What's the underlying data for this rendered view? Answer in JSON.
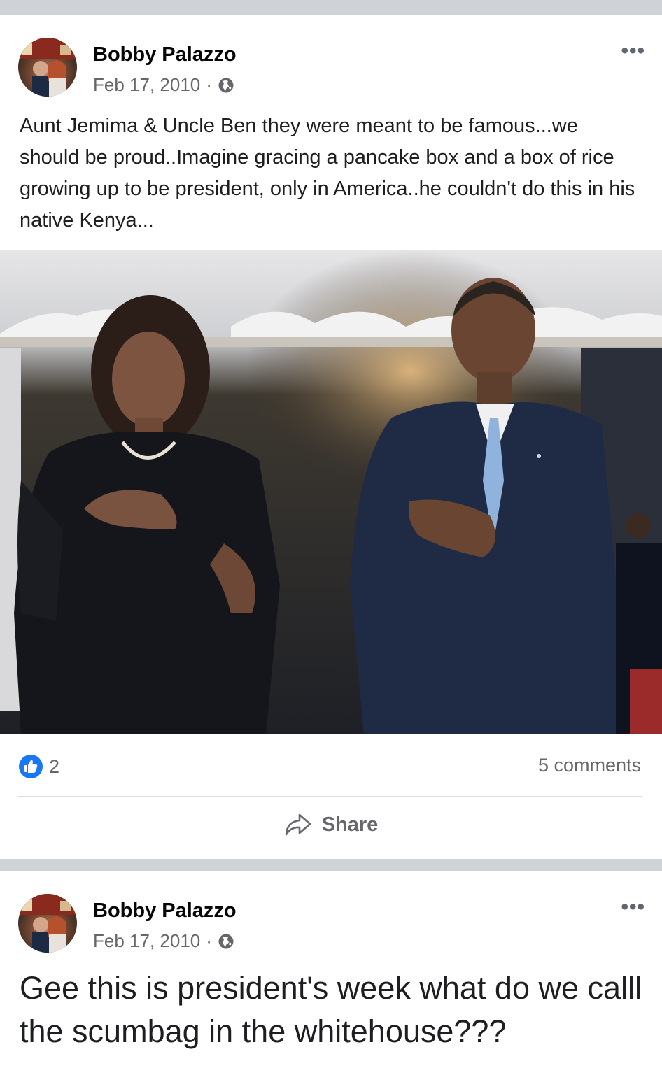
{
  "posts": [
    {
      "author": "Bobby Palazzo",
      "date": "Feb 17, 2010",
      "separator": "·",
      "privacy_icon": "globe-icon",
      "more_label": "•••",
      "text": "Aunt Jemima & Uncle Ben they were meant to be famous...we should be proud..Imagine gracing a pancake box and a box of rice growing up to be president, only in America..he couldn't do this in his native Kenya...",
      "reaction_count": "2",
      "comments_label": "5 comments",
      "share_label": "Share"
    },
    {
      "author": "Bobby Palazzo",
      "date": "Feb 17, 2010",
      "separator": "·",
      "privacy_icon": "globe-icon",
      "more_label": "•••",
      "text": "Gee this is president's week what do we calll the scumbag in the whitehouse???"
    }
  ],
  "colors": {
    "like_blue": "#1877f2",
    "secondary_text": "#65676b",
    "separator_gray": "#cfd2d7"
  }
}
